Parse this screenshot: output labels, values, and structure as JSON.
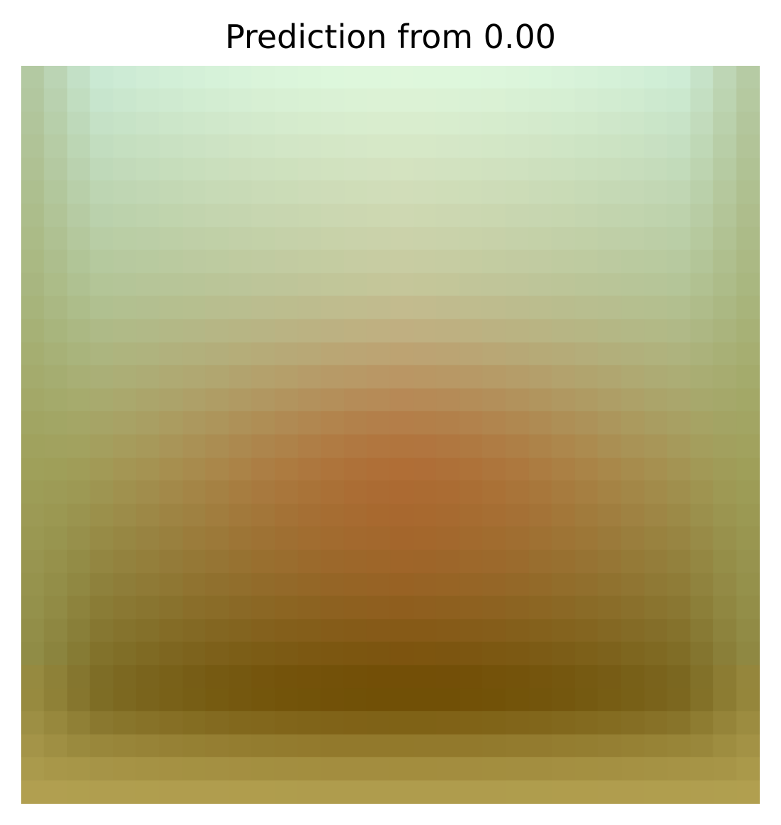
{
  "title": "Prediction from 0.00",
  "image": {
    "grid_size": 32,
    "palette": {
      "top_center": "#e0fae0",
      "top_edge": "#c1e4d2",
      "middle": "#b8804c",
      "center_warm": "#a85c22",
      "dark_core": "#6b4a00",
      "bottom_edge": "#b4a252",
      "side_edge": "#9fa05a"
    }
  }
}
